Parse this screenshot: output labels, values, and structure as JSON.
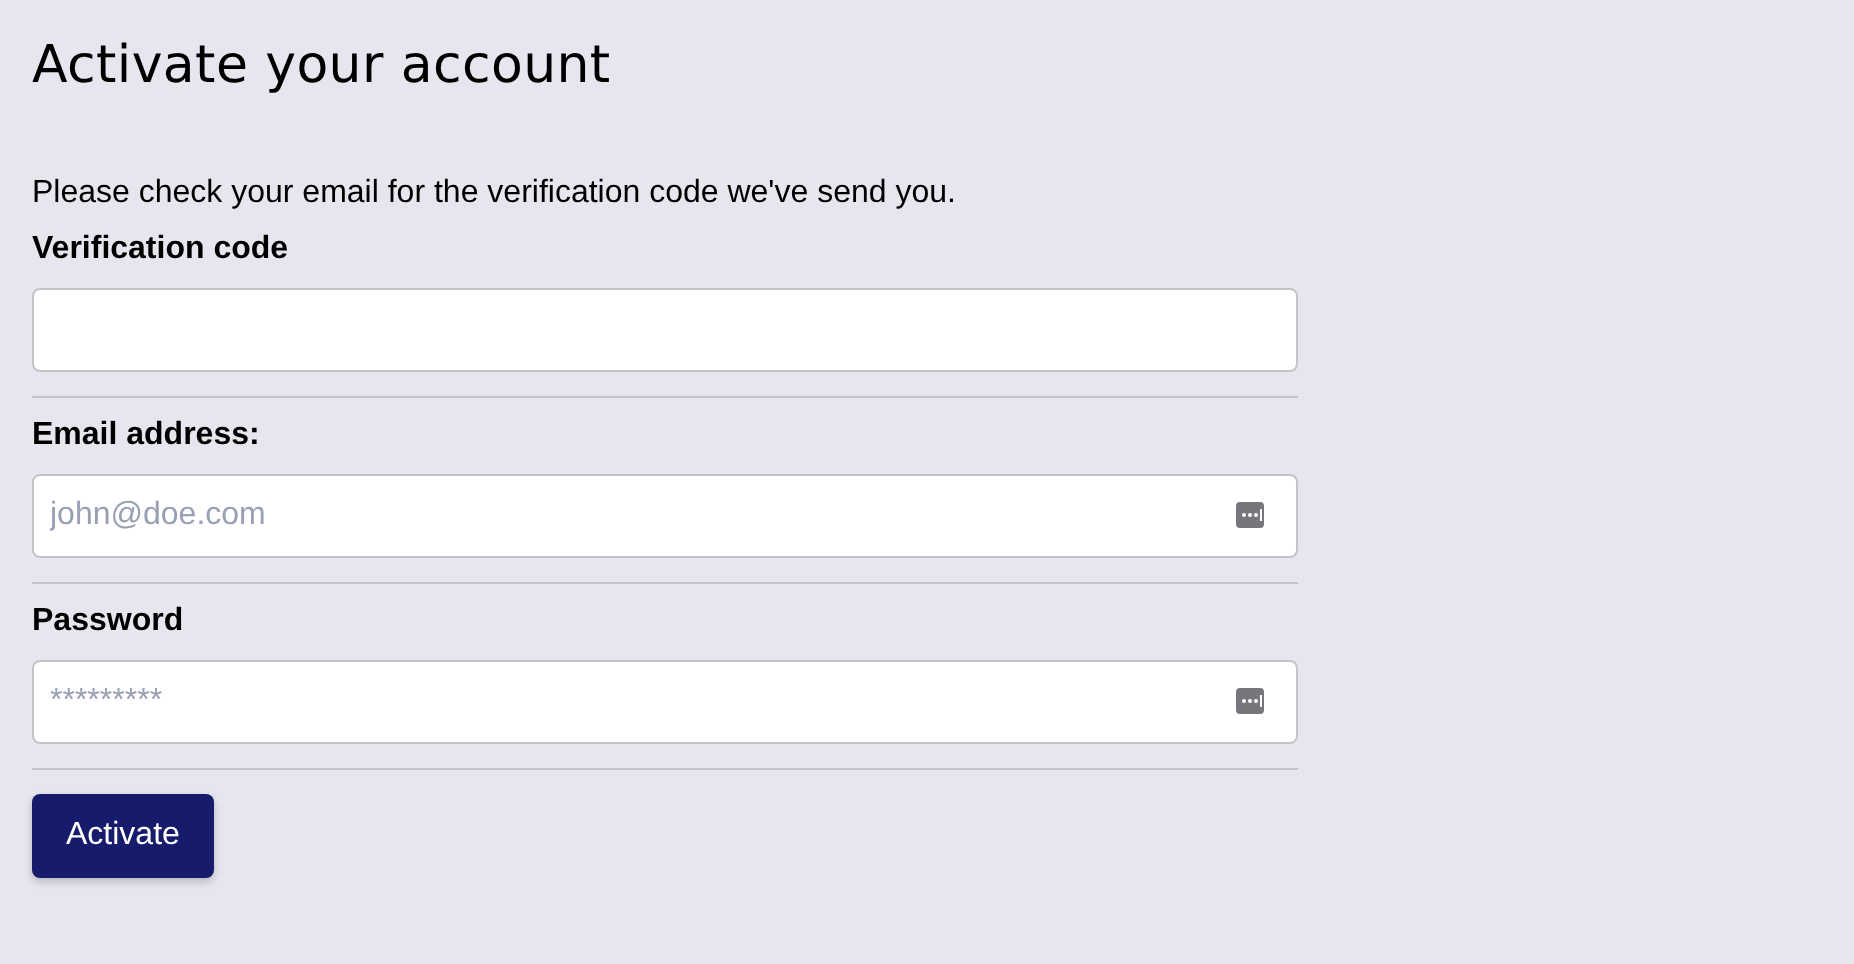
{
  "title": "Activate your account",
  "intro": "Please check your email for the verification code we've send you.",
  "fields": [
    {
      "label": "Verification code",
      "autofill": false
    },
    {
      "label": "Email address:",
      "placeholder": "john@doe.com",
      "autofill": true
    },
    {
      "label": "Password",
      "placeholder": "*********",
      "autofill": true
    }
  ],
  "button": "Activate"
}
